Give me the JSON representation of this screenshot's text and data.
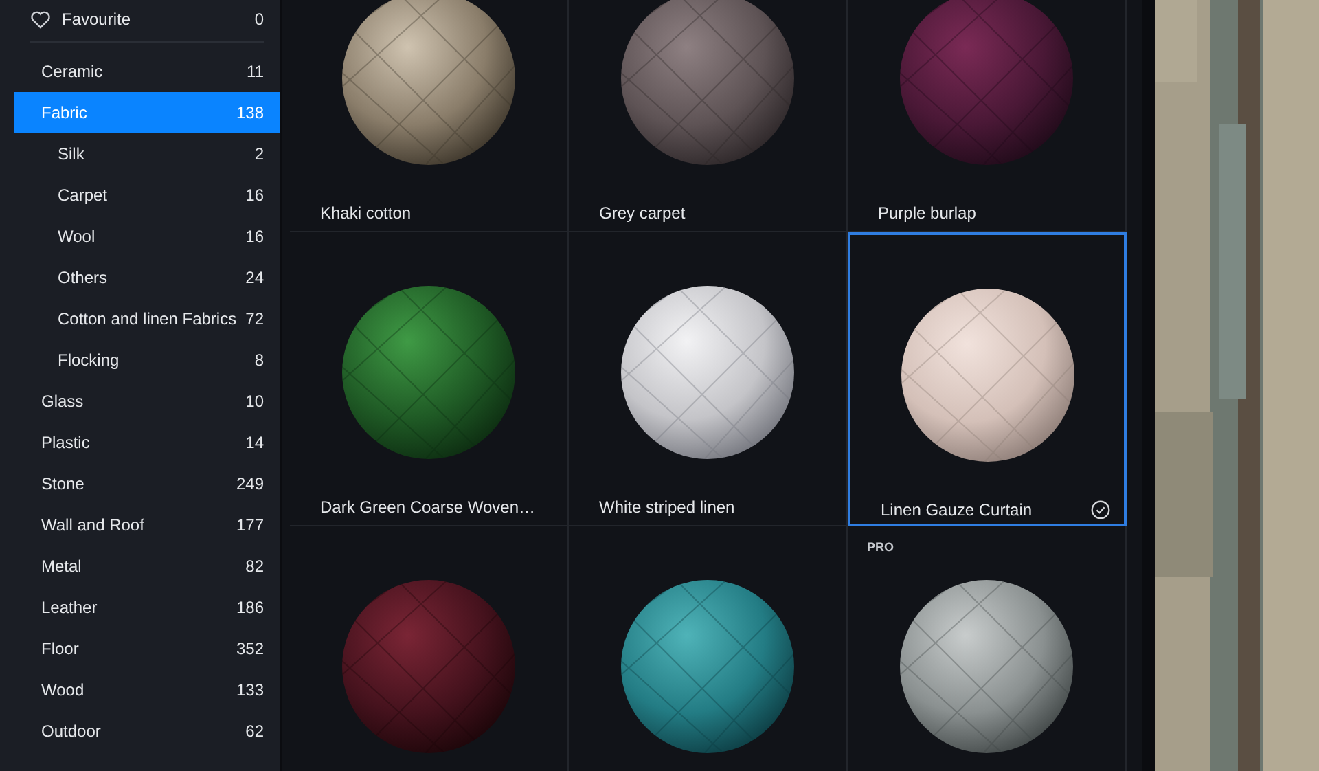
{
  "sidebar": {
    "favourite": {
      "label": "Favourite",
      "count": "0"
    },
    "categories": [
      {
        "label": "Ceramic",
        "count": "11",
        "selected": false
      },
      {
        "label": "Fabric",
        "count": "138",
        "selected": true,
        "children": [
          {
            "label": "Silk",
            "count": "2",
            "selected": false
          },
          {
            "label": "Carpet",
            "count": "16",
            "selected": false
          },
          {
            "label": "Wool",
            "count": "16",
            "selected": false
          },
          {
            "label": "Others",
            "count": "24",
            "selected": false
          },
          {
            "label": "Cotton and linen Fabrics",
            "count": "72",
            "selected": false
          },
          {
            "label": "Flocking",
            "count": "8",
            "selected": false
          }
        ]
      },
      {
        "label": "Glass",
        "count": "10",
        "selected": false
      },
      {
        "label": "Plastic",
        "count": "14",
        "selected": false
      },
      {
        "label": "Stone",
        "count": "249",
        "selected": false
      },
      {
        "label": "Wall and Roof",
        "count": "177",
        "selected": false
      },
      {
        "label": "Metal",
        "count": "82",
        "selected": false
      },
      {
        "label": "Leather",
        "count": "186",
        "selected": false
      },
      {
        "label": "Floor",
        "count": "352",
        "selected": false
      },
      {
        "label": "Wood",
        "count": "133",
        "selected": false
      },
      {
        "label": "Outdoor",
        "count": "62",
        "selected": false
      }
    ]
  },
  "materials": [
    {
      "name": "Khaki cotton",
      "selected": false
    },
    {
      "name": "Grey carpet",
      "selected": false
    },
    {
      "name": "Purple burlap",
      "selected": false
    },
    {
      "name": "Dark Green Coarse Woven…",
      "selected": false
    },
    {
      "name": "White striped linen",
      "selected": false
    },
    {
      "name": "Linen Gauze Curtain",
      "selected": true
    },
    {
      "selected": false
    },
    {
      "selected": false
    },
    {
      "selected": false,
      "badge": "PRO"
    }
  ]
}
